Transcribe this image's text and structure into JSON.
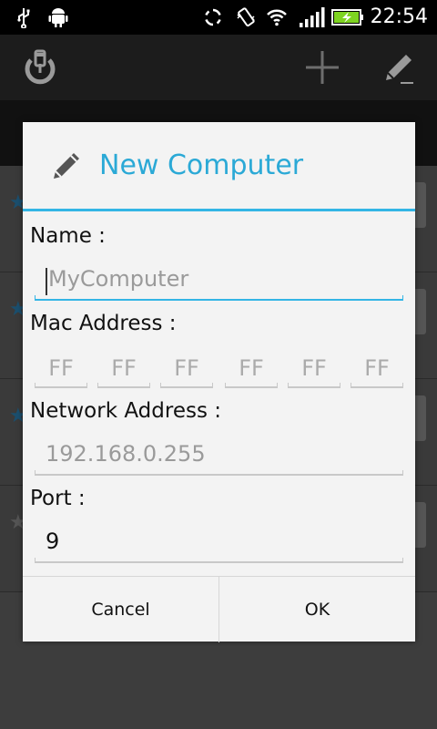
{
  "status_bar": {
    "time": "22:54",
    "icons": [
      "usb-icon",
      "android-debug-icon",
      "sync-icon",
      "vibrate-icon",
      "wifi-icon",
      "signal-icon",
      "battery-charging-icon"
    ],
    "battery_color": "#7ed321"
  },
  "action_bar": {
    "icons": [
      "power-app-icon",
      "add-icon",
      "edit-icon"
    ]
  },
  "dialog": {
    "title": "New Computer",
    "title_color": "#2ba9d6",
    "accent_color": "#33b5e5",
    "name": {
      "label": "Name :",
      "placeholder": "MyComputer",
      "value": ""
    },
    "mac": {
      "label": "Mac Address :",
      "octets": [
        "FF",
        "FF",
        "FF",
        "FF",
        "FF",
        "FF"
      ]
    },
    "network": {
      "label": "Network Address :",
      "placeholder": "192.168.0.255",
      "value": ""
    },
    "port": {
      "label": "Port :",
      "value": "9"
    },
    "buttons": {
      "cancel": "Cancel",
      "ok": "OK"
    }
  }
}
